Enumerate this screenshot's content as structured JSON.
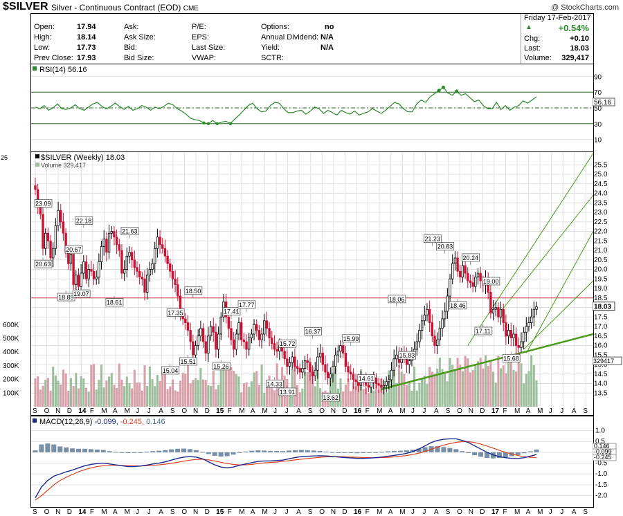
{
  "header": {
    "symbol": "$SILVER",
    "description": "Silver - Continuous Contract (EOD)",
    "exchange": "CME",
    "copyright": "@ StockCharts.com"
  },
  "quote": {
    "date": "Friday  17-Feb-2017",
    "open_label": "Open:",
    "open": "17.94",
    "high_label": "High:",
    "high": "18.14",
    "low_label": "Low:",
    "low": "17.73",
    "prev_label": "Prev Close:",
    "prev": "17.93",
    "ask_label": "Ask:",
    "asksize_label": "Ask Size:",
    "bid_label": "Bid:",
    "bidsize_label": "Bid Size:",
    "pe_label": "P/E:",
    "eps_label": "EPS:",
    "lastsize_label": "Last Size:",
    "vwap_label": "VWAP:",
    "options_label": "Options:",
    "options": "no",
    "div_label": "Annual Dividend:",
    "div": "N/A",
    "yield_label": "Yield:",
    "yield": "N/A",
    "sctr_label": "SCTR:",
    "pct": "+0.54%",
    "chg_label": "Chg:",
    "chg": "+0.10",
    "last_label": "Last:",
    "last": "18.03",
    "vol_label": "Volume:",
    "vol": "329,417"
  },
  "colors": {
    "up": "#000000",
    "down": "#cc1133",
    "rsi": "#2a8a2a",
    "grid": "#e0e0e0",
    "trend": "#4a9a1a",
    "macd": "#1a2a8a",
    "signal": "#e04020",
    "hist": "#4a6a8a",
    "vol_up": "#9dbf9d",
    "vol_down": "#d8a0a8"
  },
  "chart_data": [
    {
      "type": "line",
      "title": "RSI(14) 56.16",
      "name": "RSI(14)",
      "value_label": "56.16",
      "yticks": [
        "90",
        "70",
        "50",
        "30",
        "10"
      ],
      "ylim": [
        0,
        100
      ],
      "values": [
        51,
        49,
        53,
        47,
        50,
        55,
        49,
        48,
        50,
        54,
        49,
        47,
        51,
        55,
        57,
        52,
        49,
        52,
        56,
        52,
        48,
        52,
        47,
        49,
        53,
        51,
        47,
        51,
        49,
        52,
        56,
        54,
        49,
        46,
        42,
        37,
        35,
        34,
        31,
        30,
        34,
        30,
        32,
        33,
        30,
        36,
        41,
        47,
        53,
        56,
        49,
        45,
        46,
        53,
        57,
        56,
        49,
        44,
        44,
        46,
        47,
        42,
        46,
        51,
        49,
        43,
        47,
        44,
        41,
        47,
        44,
        42,
        46,
        41,
        43,
        45,
        49,
        46,
        43,
        47,
        52,
        57,
        55,
        49,
        45,
        45,
        55,
        60,
        57,
        64,
        68,
        72,
        76,
        69,
        66,
        71,
        66,
        68,
        63,
        58,
        60,
        53,
        49,
        49,
        57,
        48,
        53,
        47,
        51,
        53,
        59,
        56,
        60,
        64
      ],
      "levels": [
        70,
        30
      ]
    },
    {
      "type": "candlestick",
      "title": "$SILVER (Weekly) 18.03",
      "volume_label": "Volume 329,417",
      "yticks": [
        "25.5",
        "25.0",
        "24.5",
        "24.0",
        "23.5",
        "23.0",
        "22.5",
        "22.0",
        "21.5",
        "21.0",
        "20.5",
        "20.0",
        "19.5",
        "19.0",
        "18.5",
        "18.0",
        "17.5",
        "17.0",
        "16.5",
        "16.0",
        "15.5",
        "15.0",
        "14.5",
        "14.0",
        "13.5"
      ],
      "ylim": [
        13.0,
        25.8
      ],
      "last_label": "18.03",
      "volume_marker": "329417",
      "volume_yticks": [
        "600K",
        "500K",
        "400K",
        "300K",
        "200K",
        "100K"
      ],
      "volume_ylim": [
        0,
        650000
      ],
      "horizontal_level": 18.5,
      "x_month_labels": [
        "S",
        "O",
        "N",
        "D",
        "14",
        "F",
        "M",
        "A",
        "M",
        "J",
        "J",
        "A",
        "S",
        "O",
        "N",
        "D",
        "15",
        "F",
        "M",
        "A",
        "M",
        "J",
        "J",
        "A",
        "S",
        "O",
        "N",
        "D",
        "16",
        "F",
        "M",
        "A",
        "M",
        "J",
        "J",
        "A",
        "S",
        "O",
        "N",
        "D",
        "17",
        "F",
        "M",
        "A",
        "M",
        "J",
        "J",
        "A",
        "S"
      ],
      "x_month_bold": [
        "14",
        "15",
        "16",
        "17"
      ],
      "close": [
        24.2,
        23.3,
        22.9,
        21.1,
        21.9,
        21.5,
        20.6,
        21.1,
        22.3,
        23.1,
        22.5,
        21.9,
        20.9,
        20.3,
        20.8,
        19.2,
        19.7,
        19.1,
        19.8,
        20.4,
        19.5,
        20.0,
        19.9,
        19.5,
        19.6,
        20.4,
        21.2,
        21.6,
        20.9,
        21.9,
        22.0,
        21.7,
        21.3,
        21.0,
        19.8,
        20.0,
        20.7,
        20.9,
        20.5,
        20.1,
        19.9,
        19.6,
        19.5,
        18.8,
        19.7,
        20.0,
        20.3,
        21.1,
        21.7,
        21.3,
        21.1,
        20.7,
        20.3,
        19.9,
        19.5,
        19.2,
        18.6,
        17.6,
        17.4,
        17.2,
        16.8,
        16.2,
        15.5,
        16.0,
        16.5,
        16.9,
        16.2,
        15.6,
        16.5,
        17.0,
        16.7,
        15.8,
        16.6,
        17.5,
        18.3,
        17.5,
        16.9,
        16.3,
        15.8,
        16.6,
        17.2,
        16.3,
        16.2,
        15.8,
        16.4,
        16.6,
        17.1,
        16.8,
        16.3,
        16.6,
        17.3,
        16.9,
        16.4,
        16.1,
        15.8,
        15.7,
        16.0,
        15.7,
        15.3,
        14.9,
        15.1,
        15.4,
        14.9,
        14.8,
        14.6,
        14.8,
        15.2,
        15.1,
        14.6,
        14.4,
        14.7,
        15.4,
        15.6,
        15.0,
        14.6,
        14.3,
        14.5,
        14.9,
        15.5,
        15.7,
        16.0,
        15.6,
        14.9,
        14.6,
        14.5,
        14.2,
        14.1,
        13.9,
        14.2,
        14.1,
        13.9,
        13.8,
        14.2,
        14.3,
        14.0,
        13.9,
        13.8,
        13.9,
        14.1,
        14.2,
        14.7,
        15.3,
        15.5,
        15.1,
        15.6,
        15.5,
        15.0,
        15.2,
        15.6,
        15.8,
        16.2,
        16.8,
        17.3,
        17.6,
        17.9,
        17.2,
        16.5,
        16.0,
        16.3,
        16.9,
        17.4,
        17.8,
        18.6,
        19.5,
        20.3,
        20.6,
        19.9,
        19.6,
        20.2,
        19.8,
        19.4,
        19.3,
        19.1,
        19.6,
        19.8,
        19.4,
        19.2,
        19.5,
        18.8,
        17.7,
        17.9,
        18.0,
        17.5,
        17.9,
        17.2,
        16.5,
        16.8,
        16.4,
        16.6,
        16.0,
        15.9,
        16.2,
        16.7,
        17.0,
        17.2,
        17.5,
        17.9,
        18.03
      ],
      "annotations": [
        {
          "text": "23.09",
          "x": "Dec-13"
        },
        {
          "text": "20.63",
          "x": "Dec-13"
        },
        {
          "text": "18.89",
          "x": "Jan-14"
        },
        {
          "text": "19.07",
          "x": "Jan-14"
        },
        {
          "text": "22.18",
          "x": "Feb-14"
        },
        {
          "text": "20.67",
          "x": "Jan-14"
        },
        {
          "text": "21.63",
          "x": "Jul-14"
        },
        {
          "text": "18.61",
          "x": "Jun-14"
        },
        {
          "text": "17.35",
          "x": "Jan-15"
        },
        {
          "text": "15.04",
          "x": "Dec-14"
        },
        {
          "text": "15.51",
          "x": "Jan-15"
        },
        {
          "text": "18.50",
          "x": "Jan-15"
        },
        {
          "text": "17.41",
          "x": "Apr-15"
        },
        {
          "text": "15.26",
          "x": "Mar-15"
        },
        {
          "text": "17.77",
          "x": "May-15"
        },
        {
          "text": "15.72",
          "x": "Aug-15"
        },
        {
          "text": "14.33",
          "x": "Aug-15"
        },
        {
          "text": "13.91",
          "x": "Aug-15"
        },
        {
          "text": "16.37",
          "x": "Oct-15"
        },
        {
          "text": "13.62",
          "x": "Dec-15"
        },
        {
          "text": "15.99",
          "x": "Jan-16"
        },
        {
          "text": "14.61",
          "x": "Feb-16"
        },
        {
          "text": "18.06",
          "x": "Apr-16"
        },
        {
          "text": "15.83",
          "x": "May-16"
        },
        {
          "text": "21.23",
          "x": "Jul-16"
        },
        {
          "text": "20.83",
          "x": "Aug-16"
        },
        {
          "text": "18.46",
          "x": "Sep-16"
        },
        {
          "text": "20.24",
          "x": "Sep-16"
        },
        {
          "text": "19.00",
          "x": "Nov-16"
        },
        {
          "text": "17.11",
          "x": "Nov-16"
        },
        {
          "text": "15.68",
          "x": "Dec-16"
        }
      ]
    },
    {
      "type": "line",
      "title": "MACD(12,26,9)",
      "macd_label": "-0.099,",
      "signal_label": "-0.245,",
      "hist_label": "0.146",
      "yticks": [
        "1.0",
        "0.5",
        "0.0",
        "-0.5",
        "-1.0",
        "-1.5",
        "-2.0"
      ],
      "ylim": [
        -2.3,
        1.4
      ],
      "right_labels": [
        "0.146",
        "-0.099",
        "-0.245"
      ],
      "macd": [
        -2.1,
        -1.6,
        -1.3,
        -1.1,
        -1.0,
        -0.9,
        -0.82,
        -0.72,
        -0.62,
        -0.56,
        -0.52,
        -0.5,
        -0.54,
        -0.58,
        -0.62,
        -0.66,
        -0.66,
        -0.63,
        -0.59,
        -0.54,
        -0.5,
        -0.44,
        -0.36,
        -0.28,
        -0.22,
        -0.2,
        -0.22,
        -0.3,
        -0.44,
        -0.58,
        -0.68,
        -0.72,
        -0.68,
        -0.6,
        -0.54,
        -0.48,
        -0.42,
        -0.4,
        -0.4,
        -0.38,
        -0.36,
        -0.3,
        -0.24,
        -0.2,
        -0.18,
        -0.17,
        -0.16,
        -0.17,
        -0.19,
        -0.22,
        -0.24,
        -0.26,
        -0.28,
        -0.28,
        -0.27,
        -0.25,
        -0.22,
        -0.18,
        -0.14,
        -0.1,
        -0.05,
        0.03,
        0.15,
        0.3,
        0.45,
        0.55,
        0.6,
        0.62,
        0.62,
        0.55,
        0.45,
        0.3,
        0.15,
        0.0,
        -0.12,
        -0.2,
        -0.25,
        -0.28,
        -0.29,
        -0.25,
        -0.18,
        -0.1
      ],
      "signal": [
        -2.2,
        -2.0,
        -1.75,
        -1.5,
        -1.3,
        -1.15,
        -1.02,
        -0.9,
        -0.8,
        -0.72,
        -0.66,
        -0.62,
        -0.6,
        -0.6,
        -0.61,
        -0.62,
        -0.63,
        -0.63,
        -0.62,
        -0.6,
        -0.58,
        -0.55,
        -0.51,
        -0.46,
        -0.41,
        -0.36,
        -0.33,
        -0.32,
        -0.35,
        -0.4,
        -0.46,
        -0.52,
        -0.56,
        -0.58,
        -0.58,
        -0.56,
        -0.52,
        -0.49,
        -0.47,
        -0.45,
        -0.42,
        -0.39,
        -0.35,
        -0.32,
        -0.29,
        -0.26,
        -0.23,
        -0.21,
        -0.2,
        -0.2,
        -0.21,
        -0.22,
        -0.23,
        -0.24,
        -0.25,
        -0.25,
        -0.24,
        -0.23,
        -0.21,
        -0.18,
        -0.15,
        -0.1,
        -0.04,
        0.04,
        0.14,
        0.24,
        0.33,
        0.4,
        0.46,
        0.49,
        0.49,
        0.45,
        0.38,
        0.29,
        0.19,
        0.09,
        0.0,
        -0.08,
        -0.15,
        -0.2,
        -0.23,
        -0.245
      ]
    }
  ]
}
